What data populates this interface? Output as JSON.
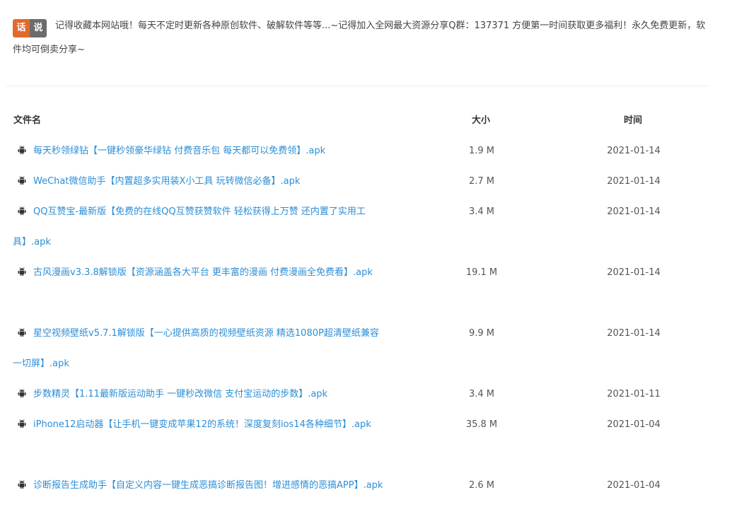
{
  "notice": {
    "badge_left": "话",
    "badge_right": "说",
    "text": "记得收藏本网站哦！每天不定时更新各种原创软件、破解软件等等...~记得加入全网最大资源分享Q群：137371 方便第一时间获取更多福利！永久免费更新，软件均可倒卖分享~"
  },
  "table": {
    "headers": {
      "name": "文件名",
      "size": "大小",
      "time": "时间"
    },
    "rows": [
      {
        "name": "每天秒领绿钻【一键秒领豪华绿钻 付费音乐包 每天都可以免费领】.apk",
        "size": "1.9 M",
        "time": "2021-01-14",
        "lines": 1
      },
      {
        "name": "WeChat微信助手【内置超多实用装X小工具 玩转微信必备】.apk",
        "size": "2.7 M",
        "time": "2021-01-14",
        "lines": 1
      },
      {
        "name": "QQ互赞宝-最新版【免费的在线QQ互赞获赞软件 轻松获得上万赞 还内置了实用工具】.apk",
        "size": "3.4 M",
        "time": "2021-01-14",
        "lines": 2
      },
      {
        "name": "古风漫画v3.3.8解锁版【资源涵盖各大平台 更丰富的漫画 付费漫画全免费看】.apk",
        "size": "19.1 M",
        "time": "2021-01-14",
        "lines": 2
      },
      {
        "name": "星空视频壁纸v5.7.1解锁版【一心提供高质的视频壁纸资源 精选1080P超清壁纸兼容一切屏】.apk",
        "size": "9.9 M",
        "time": "2021-01-14",
        "lines": 2
      },
      {
        "name": "步数精灵【1.11最新版运动助手 一键秒改微信 支付宝运动的步数】.apk",
        "size": "3.4 M",
        "time": "2021-01-11",
        "lines": 1
      },
      {
        "name": "iPhone12启动器【让手机一键变成苹果12的系统！深度复刻ios14各种细节】.apk",
        "size": "35.8 M",
        "time": "2021-01-04",
        "lines": 2
      },
      {
        "name": "诊断报告生成助手【自定义内容一键生成恶搞诊断报告图！增进感情的恶搞APP】.apk",
        "size": "2.6 M",
        "time": "2021-01-04",
        "lines": 2
      }
    ]
  },
  "colors": {
    "link": "#2c8ed6",
    "badge_left": "#e06a2c",
    "badge_right": "#6c6c6c"
  },
  "icon": "android-icon"
}
